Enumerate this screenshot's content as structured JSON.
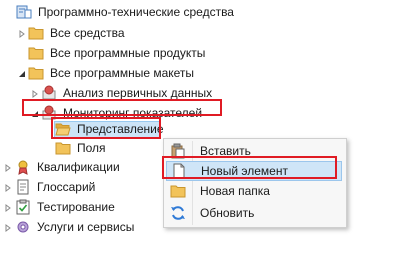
{
  "tree": {
    "root": {
      "label": "Программно-технические средства",
      "icon": "software-hardware-icon"
    },
    "items": [
      {
        "label": "Все средства",
        "icon": "folder-icon"
      },
      {
        "label": "Все программные продукты",
        "icon": "folder-icon"
      },
      {
        "label": "Все программные макеты",
        "icon": "folder-icon"
      },
      {
        "label": "Анализ первичных данных",
        "icon": "analysis-icon"
      },
      {
        "label": "Мониторинг показателей",
        "icon": "monitoring-icon"
      },
      {
        "label": "Представление",
        "icon": "folder-open-icon"
      },
      {
        "label": "Поля",
        "icon": "folder-icon"
      },
      {
        "label": "Квалификации",
        "icon": "qualification-icon"
      },
      {
        "label": "Глоссарий",
        "icon": "glossary-icon"
      },
      {
        "label": "Тестирование",
        "icon": "testing-icon"
      },
      {
        "label": "Услуги и сервисы",
        "icon": "services-icon"
      }
    ]
  },
  "context_menu": {
    "items": [
      {
        "label": "Вставить",
        "icon": "paste-icon"
      },
      {
        "label": "Новый элемент",
        "icon": "new-item-icon"
      },
      {
        "label": "Новая папка",
        "icon": "new-folder-icon"
      },
      {
        "label": "Обновить",
        "icon": "refresh-icon"
      }
    ],
    "highlighted_index": 1
  },
  "colors": {
    "highlight_outline": "#e01b24",
    "selection": "#cce4f7",
    "folder": "#f2c35a"
  }
}
